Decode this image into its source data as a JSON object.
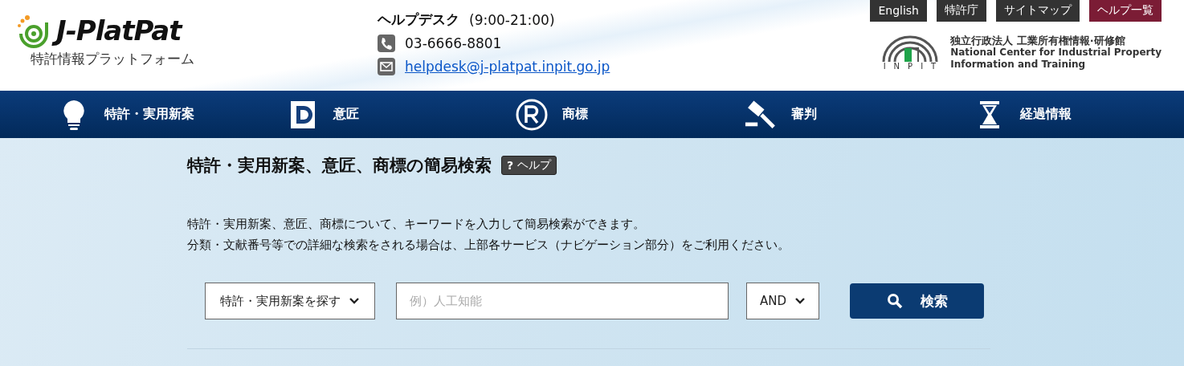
{
  "logo": {
    "name": "J-PlatPat",
    "subtitle": "特許情報プラットフォーム"
  },
  "helpdesk": {
    "title": "ヘルプデスク",
    "hours": "(9:00-21:00)",
    "phone": "03-6666-8801",
    "email": "helpdesk@j-platpat.inpit.go.jp"
  },
  "top_links": [
    {
      "label": "English",
      "kind": "plain"
    },
    {
      "label": "特許庁",
      "kind": "plain"
    },
    {
      "label": "サイトマップ",
      "kind": "plain"
    },
    {
      "label": "ヘルプ一覧",
      "kind": "accent"
    }
  ],
  "org": {
    "mark": "INPIT",
    "name_ja": "独立行政法人 工業所有権情報·研修館",
    "name_en_1": "National Center for Industrial Property",
    "name_en_2": "Information and Training"
  },
  "nav": [
    {
      "label": "特許・実用新案",
      "kind": "bulb"
    },
    {
      "label": "意匠",
      "kind": "design"
    },
    {
      "label": "商標",
      "kind": "registered"
    },
    {
      "label": "審判",
      "kind": "gavel"
    },
    {
      "label": "経過情報",
      "kind": "hourglass"
    }
  ],
  "search": {
    "title": "特許・実用新案、意匠、商標の簡易検索",
    "help": "ヘルプ",
    "help_mark": "?",
    "description": [
      "特許・実用新案、意匠、商標について、キーワードを入力して簡易検索ができます。",
      "分類・文献番号等での詳細な検索をされる場合は、上部各サービス（ナビゲーション部分）をご利用ください。"
    ],
    "category": "特許・実用新案を探す",
    "placeholder": "例）人工知能",
    "operator": "AND",
    "button": "検索"
  }
}
